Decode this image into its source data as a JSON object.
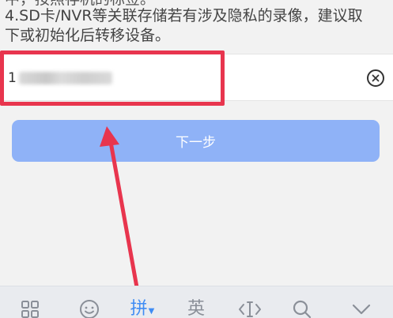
{
  "notice": {
    "cut_line": "中，按照存机的标签。",
    "line1": "4.SD卡/NVR等关联存储若有涉及隐私的录像，建议取",
    "line2": "下或初始化后转移设备。"
  },
  "input": {
    "visible_prefix": "1"
  },
  "next_button": {
    "label": "下一步"
  },
  "colors": {
    "highlight": "#e8354e",
    "button": "#8fb2f7",
    "ime_active": "#3f8cf4"
  },
  "keyboard": {
    "items": [
      {
        "icon": "grid-icon"
      },
      {
        "icon": "emoji-icon"
      },
      {
        "label": "拼",
        "icon": "pinyin-mode"
      },
      {
        "label": "英",
        "icon": "english-mode"
      },
      {
        "icon": "cursor-icon"
      },
      {
        "icon": "search-icon"
      },
      {
        "icon": "chevron-down-icon"
      }
    ]
  }
}
